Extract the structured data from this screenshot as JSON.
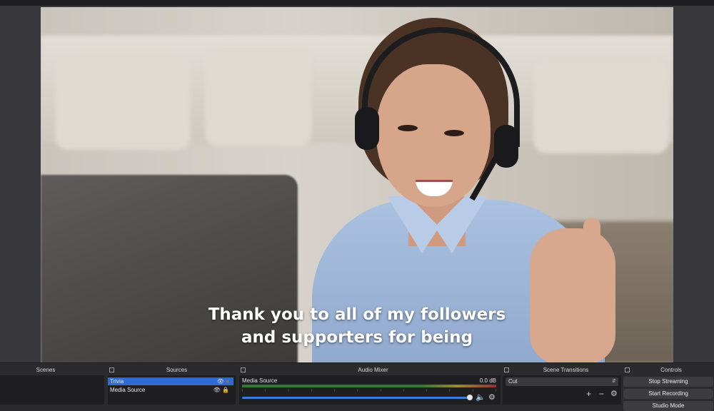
{
  "preview": {
    "caption_line1": "Thank you to all of my followers",
    "caption_line2": "and supporters for being"
  },
  "dock": {
    "scenes": {
      "title": "Scenes"
    },
    "sources": {
      "title": "Sources",
      "items": [
        {
          "label": "Trivia",
          "selected": true
        },
        {
          "label": "Media Source",
          "selected": false
        }
      ]
    },
    "audio_mixer": {
      "title": "Audio Mixer",
      "channel_name": "Media Source",
      "level": "0.0 dB",
      "volume_fraction": 0.95
    },
    "scene_transitions": {
      "title": "Scene Transitions",
      "selected": "Cut"
    },
    "controls": {
      "title": "Controls",
      "buttons": [
        "Stop Streaming",
        "Start Recording",
        "Studio Mode"
      ]
    }
  },
  "icons": {
    "eye": "eye-icon",
    "lock": "lock-icon",
    "speaker": "speaker-icon",
    "gear": "gear-icon",
    "add": "add-icon",
    "remove": "remove-icon"
  }
}
